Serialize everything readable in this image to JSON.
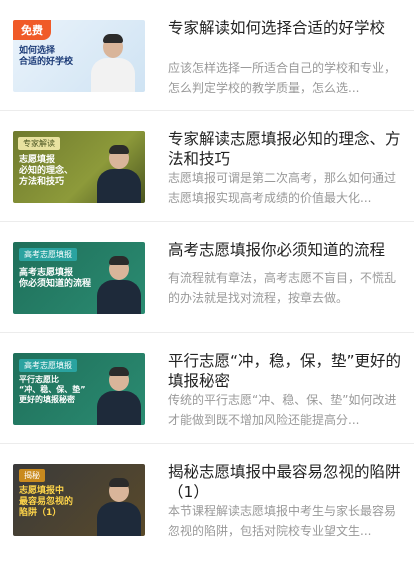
{
  "items": [
    {
      "title": "专家解读如何选择合适的好学校",
      "description": "应该怎样选择一所适合自己的学校和专业，怎么判定学校的教学质量，怎么选...",
      "badge": "免费",
      "thumb_text": "如何选择\n合适的好学校"
    },
    {
      "title": "专家解读志愿填报必知的理念、方法和技巧",
      "description": "志愿填报可谓是第二次高考，那么如何通过志愿填报实现高考成绩的价值最大化...",
      "thumb_tag": "专家解读",
      "thumb_text": "志愿填报\n必知的理念、\n方法和技巧"
    },
    {
      "title": "高考志愿填报你必须知道的流程",
      "description": "有流程就有章法，高考志愿不盲目，不慌乱的办法就是找对流程，按章去做。",
      "thumb_tag": "高考志愿填报",
      "thumb_text": "高考志愿填报\n你必须知道的流程"
    },
    {
      "title": "平行志愿“冲，稳，保，垫”更好的填报秘密",
      "description": "传统的平行志愿“冲、稳、保、垫”如何改进才能做到既不增加风险还能提高分...",
      "thumb_tag": "高考志愿填报",
      "thumb_text": "平行志愿比\n“冲、稳、保、垫”\n更好的填报秘密"
    },
    {
      "title": "揭秘志愿填报中最容易忽视的陷阱（1）",
      "description": "本节课程解读志愿填报中考生与家长最容易忽视的陷阱，包括对院校专业望文生...",
      "thumb_tag": "揭秘",
      "thumb_text": "志愿填报中\n最容易忽视的\n陷阱（1）"
    }
  ]
}
